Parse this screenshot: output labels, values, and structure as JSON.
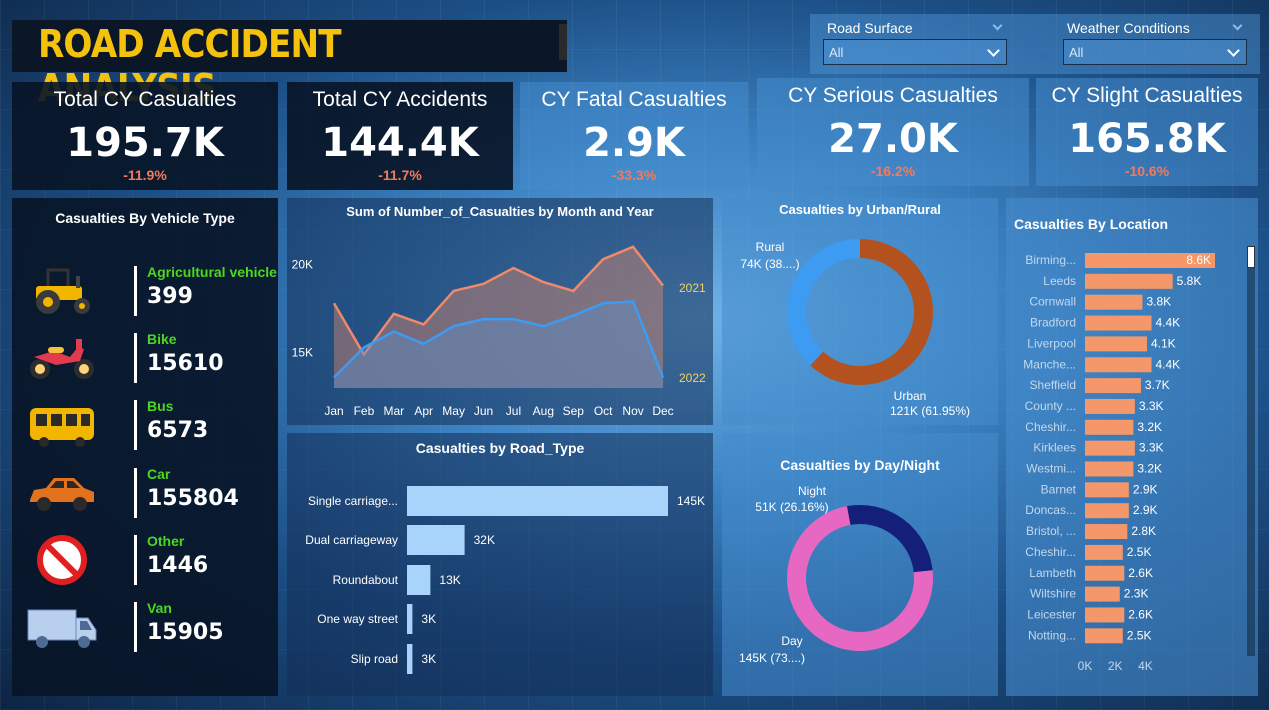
{
  "title": "ROAD ACCIDENT ANALYSIS",
  "slicers": [
    {
      "label": "Road Surface",
      "value": "All"
    },
    {
      "label": "Weather Conditions",
      "value": "All"
    }
  ],
  "kpis": [
    {
      "title": "Total CY Casualties",
      "value": "195.7K",
      "change": "-11.9%"
    },
    {
      "title": "Total CY Accidents",
      "value": "144.4K",
      "change": "-11.7%"
    },
    {
      "title": "CY Fatal Casualties",
      "value": "2.9K",
      "change": "-33.3%"
    },
    {
      "title": "CY Serious Casualties",
      "value": "27.0K",
      "change": "-16.2%"
    },
    {
      "title": "CY Slight Casualties",
      "value": "165.8K",
      "change": "-10.6%"
    }
  ],
  "vehicle_panel": {
    "title": "Casualties By Vehicle Type",
    "items": [
      {
        "name": "Agricultural vehicle",
        "count": "399",
        "icon": "tractor-icon"
      },
      {
        "name": "Bike",
        "count": "15610",
        "icon": "motorbike-icon"
      },
      {
        "name": "Bus",
        "count": "6573",
        "icon": "bus-icon"
      },
      {
        "name": "Car",
        "count": "155804",
        "icon": "car-icon"
      },
      {
        "name": "Other",
        "count": "1446",
        "icon": "prohibited-icon"
      },
      {
        "name": "Van",
        "count": "15905",
        "icon": "van-icon"
      }
    ]
  },
  "colors": {
    "title": "#f4c20d",
    "vehicle_name": "#4bd81f",
    "kpi_change": "#f47a5c",
    "line_2021": "#f0896a",
    "line_2022": "#3e9bf2",
    "urban": "#b3521f",
    "rural": "#3e9bf2",
    "day": "#e768c3",
    "night": "#141f7a",
    "road_bar": "#a8d3fb",
    "location_bar": "#f4976a"
  },
  "chart_data": [
    {
      "type": "area",
      "title": "Sum of Number_of_Casualties by Month and Year",
      "categories": [
        "Jan",
        "Feb",
        "Mar",
        "Apr",
        "May",
        "Jun",
        "Jul",
        "Aug",
        "Sep",
        "Oct",
        "Nov",
        "Dec"
      ],
      "yticks": [
        "20K",
        "15K"
      ],
      "ylim": [
        13000,
        21500
      ],
      "series": [
        {
          "name": "2021",
          "values": [
            17800,
            14900,
            17200,
            16600,
            18500,
            18900,
            19800,
            19000,
            18500,
            20300,
            21000,
            18800
          ]
        },
        {
          "name": "2022",
          "values": [
            13600,
            15300,
            16200,
            15500,
            16500,
            16900,
            16900,
            16500,
            17100,
            17800,
            17900,
            13600
          ]
        }
      ]
    },
    {
      "type": "bar",
      "title": "Casualties by Road_Type",
      "categories": [
        "Single carriage...",
        "Dual carriageway",
        "Roundabout",
        "One way street",
        "Slip road"
      ],
      "values": [
        145,
        32,
        13,
        3,
        3
      ],
      "labels": [
        "145K",
        "32K",
        "13K",
        "3K",
        "3K"
      ],
      "xlim": [
        0,
        145
      ]
    },
    {
      "type": "pie",
      "title": "Casualties by Urban/Rural",
      "labels": [
        "Urban",
        "Rural"
      ],
      "values": [
        61.95,
        38.05
      ],
      "data_labels": {
        "urban_name": "Urban",
        "urban_value": "121K (61.95%)",
        "rural_name": "Rural",
        "rural_value": "74K (38....)"
      }
    },
    {
      "type": "pie",
      "title": "Casualties by Day/Night",
      "labels": [
        "Day",
        "Night"
      ],
      "values": [
        73.84,
        26.16
      ],
      "data_labels": {
        "day_name": "Day",
        "day_value": "145K (73....)",
        "night_name": "Night",
        "night_value": "51K (26.16%)"
      }
    },
    {
      "type": "bar",
      "title": "Casualties By Location",
      "categories": [
        "Birming...",
        "Leeds",
        "Cornwall",
        "Bradford",
        "Liverpool",
        "Manche...",
        "Sheffield",
        "County ...",
        "Cheshir...",
        "Kirklees",
        "Westmi...",
        "Barnet",
        "Doncas...",
        "Bristol, ...",
        "Cheshir...",
        "Lambeth",
        "Wiltshire",
        "Leicester",
        "Notting..."
      ],
      "values": [
        8.6,
        5.8,
        3.8,
        4.4,
        4.1,
        4.4,
        3.7,
        3.3,
        3.2,
        3.3,
        3.2,
        2.9,
        2.9,
        2.8,
        2.5,
        2.6,
        2.3,
        2.6,
        2.5
      ],
      "labels": [
        "8.6K",
        "5.8K",
        "3.8K",
        "4.4K",
        "4.1K",
        "4.4K",
        "3.7K",
        "3.3K",
        "3.2K",
        "3.3K",
        "3.2K",
        "2.9K",
        "2.9K",
        "2.8K",
        "2.5K",
        "2.6K",
        "2.3K",
        "2.6K",
        "2.5K"
      ],
      "xticks": [
        "0K",
        "2K",
        "4K"
      ],
      "xlim": [
        0,
        8.6
      ]
    }
  ]
}
